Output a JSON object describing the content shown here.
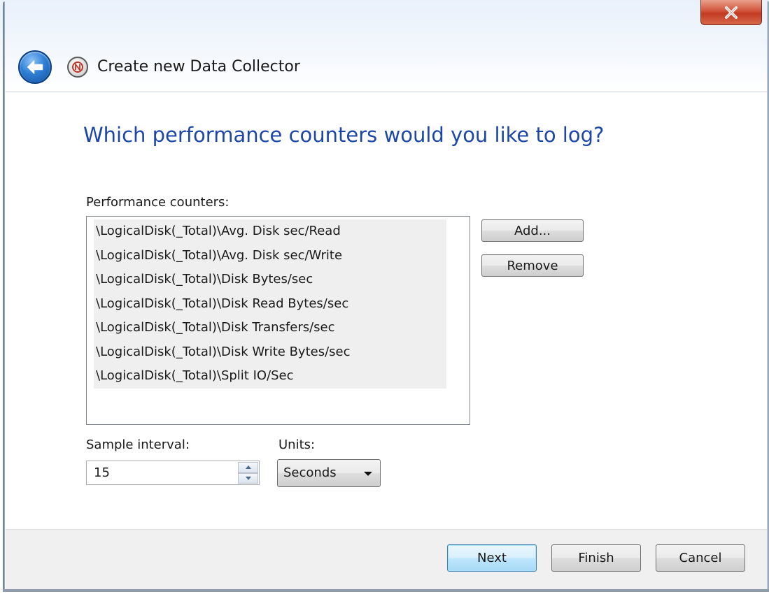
{
  "window": {
    "title": "Create new Data Collector"
  },
  "page": {
    "heading": "Which performance counters would you like to log?"
  },
  "counters": {
    "label": "Performance counters:",
    "items": [
      "\\LogicalDisk(_Total)\\Avg. Disk sec/Read",
      "\\LogicalDisk(_Total)\\Avg. Disk sec/Write",
      "\\LogicalDisk(_Total)\\Disk Bytes/sec",
      "\\LogicalDisk(_Total)\\Disk Read Bytes/sec",
      "\\LogicalDisk(_Total)\\Disk Transfers/sec",
      "\\LogicalDisk(_Total)\\Disk Write Bytes/sec",
      "\\LogicalDisk(_Total)\\Split IO/Sec"
    ],
    "add_label": "Add...",
    "remove_label": "Remove"
  },
  "sample": {
    "label": "Sample interval:",
    "value": "15"
  },
  "units": {
    "label": "Units:",
    "value": "Seconds"
  },
  "footer": {
    "next_label": "Next",
    "finish_label": "Finish",
    "cancel_label": "Cancel"
  },
  "icons": {
    "close": "close-icon",
    "back": "back-arrow-icon",
    "app": "performance-monitor-icon",
    "spin_up": "spin-up-icon",
    "spin_down": "spin-down-icon",
    "dropdown": "chevron-down-icon"
  },
  "colors": {
    "heading": "#1c47a8",
    "close": "#c23a22",
    "back": "#2f7fd6",
    "footer_bg": "#f0f0f0"
  }
}
